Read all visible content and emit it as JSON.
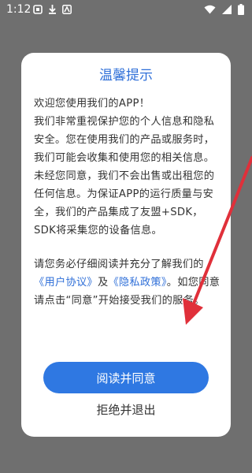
{
  "status_bar": {
    "time": "1:12",
    "left_icons": [
      "notification-icon",
      "download-icon",
      "app-icon"
    ],
    "right_icons": [
      "wifi-icon",
      "signal-icon",
      "battery-icon"
    ]
  },
  "dialog": {
    "title": "温馨提示",
    "intro_line": "欢迎您使用我们的APP！",
    "paragraph_1": "我们非常重视保护您的个人信息和隐私安全。您在使用我们的产品或服务时，我们可能会收集和使用您的相关信息。未经您同意，我们不会出售或出租您的任何信息。为保证APP的运行质量与安全，我们的产品集成了友盟+SDK，SDK将采集您的设备信息。",
    "paragraph_2_before": "请您务必仔细阅读并充分了解我们的",
    "user_agreement_link": "《用户协议》",
    "and_text": "及",
    "privacy_policy_link": "《隐私政策》",
    "paragraph_2_after": "。如您同意请点击“同意”开始接受我们的服务。",
    "accept_label": "阅读并同意",
    "decline_label": "拒绝并退出"
  },
  "colors": {
    "accent": "#2f78e2",
    "overlay": "#6f6f6f",
    "arrow": "#e0303a"
  }
}
